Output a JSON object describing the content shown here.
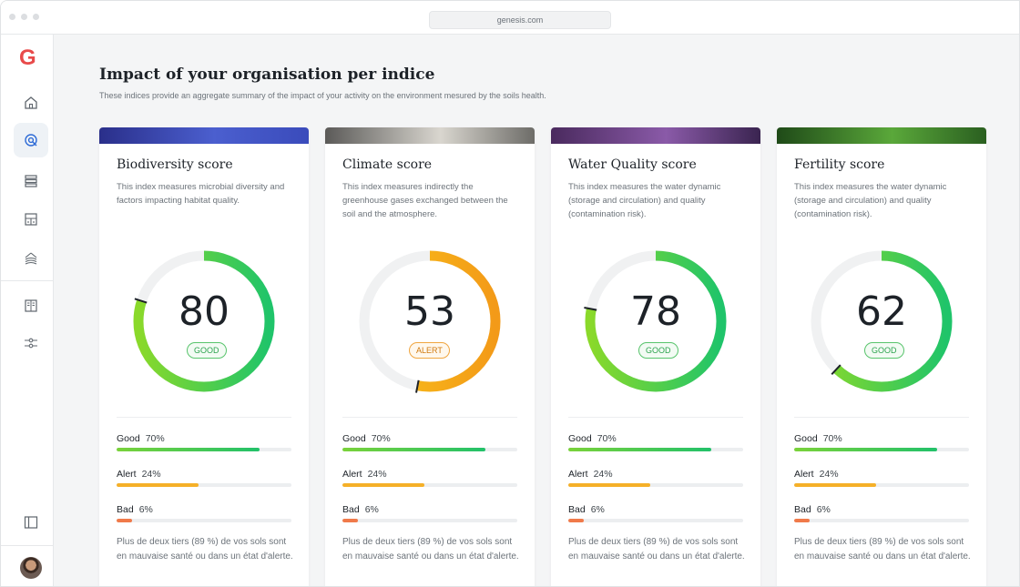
{
  "browser": {
    "url": "genesis.com"
  },
  "sidebar": {
    "logo": "G",
    "items": [
      {
        "icon": "home-icon"
      },
      {
        "icon": "target-icon",
        "active": true
      },
      {
        "icon": "layers-icon"
      },
      {
        "icon": "dashboard-icon"
      },
      {
        "icon": "soil-icon"
      },
      {
        "icon": "book-icon"
      },
      {
        "icon": "sliders-icon"
      }
    ],
    "bottom": {
      "icon": "sidebar-toggle-icon"
    },
    "avatar": "user-avatar"
  },
  "page": {
    "title": "Impact of your organisation per indice",
    "subtitle": "These indices provide an aggregate summary of the impact of your activity on the environment mesured by the soils health."
  },
  "cards": [
    {
      "title": "Biodiversity score",
      "description": "This index measures microbial diversity and factors impacting habitat quality.",
      "score": "80",
      "score_value": 80,
      "status": "GOOD",
      "status_kind": "good",
      "colors": [
        "#8ad92a",
        "#1fc46a"
      ],
      "banner": [
        "#2a2f8a",
        "#4b5fcf",
        "#3a4bbb"
      ],
      "stats": [
        {
          "label": "Good",
          "pct": "70%",
          "value": 0.82,
          "kind": "good"
        },
        {
          "label": "Alert",
          "pct": "24%",
          "value": 0.47,
          "kind": "alert"
        },
        {
          "label": "Bad",
          "pct": "6%",
          "value": 0.09,
          "kind": "bad"
        }
      ],
      "footer": "Plus de deux tiers (89 %) de vos sols sont en mauvaise santé ou dans un état d'alerte."
    },
    {
      "title": "Climate score",
      "description": "This index measures indirectly the greenhouse gases exchanged between the soil and the atmosphere.",
      "score": "53",
      "score_value": 53,
      "status": "ALERT",
      "status_kind": "alert",
      "colors": [
        "#f9c21a",
        "#f39a18"
      ],
      "banner": [
        "#5b5a58",
        "#d9d6cf",
        "#6d6c68"
      ],
      "stats": [
        {
          "label": "Good",
          "pct": "70%",
          "value": 0.82,
          "kind": "good"
        },
        {
          "label": "Alert",
          "pct": "24%",
          "value": 0.47,
          "kind": "alert"
        },
        {
          "label": "Bad",
          "pct": "6%",
          "value": 0.09,
          "kind": "bad"
        }
      ],
      "footer": "Plus de deux tiers (89 %) de vos sols sont en mauvaise santé ou dans un état d'alerte."
    },
    {
      "title": "Water Quality score",
      "description": "This index measures the water dynamic (storage and circulation) and quality (contamination risk).",
      "score": "78",
      "score_value": 78,
      "status": "GOOD",
      "status_kind": "good",
      "colors": [
        "#8ad92a",
        "#1fc46a"
      ],
      "banner": [
        "#4a2a5e",
        "#8a5aa8",
        "#3a2450"
      ],
      "stats": [
        {
          "label": "Good",
          "pct": "70%",
          "value": 0.82,
          "kind": "good"
        },
        {
          "label": "Alert",
          "pct": "24%",
          "value": 0.47,
          "kind": "alert"
        },
        {
          "label": "Bad",
          "pct": "6%",
          "value": 0.09,
          "kind": "bad"
        }
      ],
      "footer": "Plus de deux tiers (89 %) de vos sols sont en mauvaise santé ou dans un état d'alerte."
    },
    {
      "title": "Fertility score",
      "description": "This index measures the water dynamic (storage and circulation) and quality (contamination risk).",
      "score": "62",
      "score_value": 62,
      "status": "GOOD",
      "status_kind": "good",
      "colors": [
        "#8ad92a",
        "#1fc46a"
      ],
      "banner": [
        "#1f4a18",
        "#5aa83a",
        "#2a5f20"
      ],
      "stats": [
        {
          "label": "Good",
          "pct": "70%",
          "value": 0.82,
          "kind": "good"
        },
        {
          "label": "Alert",
          "pct": "24%",
          "value": 0.47,
          "kind": "alert"
        },
        {
          "label": "Bad",
          "pct": "6%",
          "value": 0.09,
          "kind": "bad"
        }
      ],
      "footer": "Plus de deux tiers (89 %) de vos sols sont en mauvaise santé ou dans un état d'alerte."
    }
  ]
}
